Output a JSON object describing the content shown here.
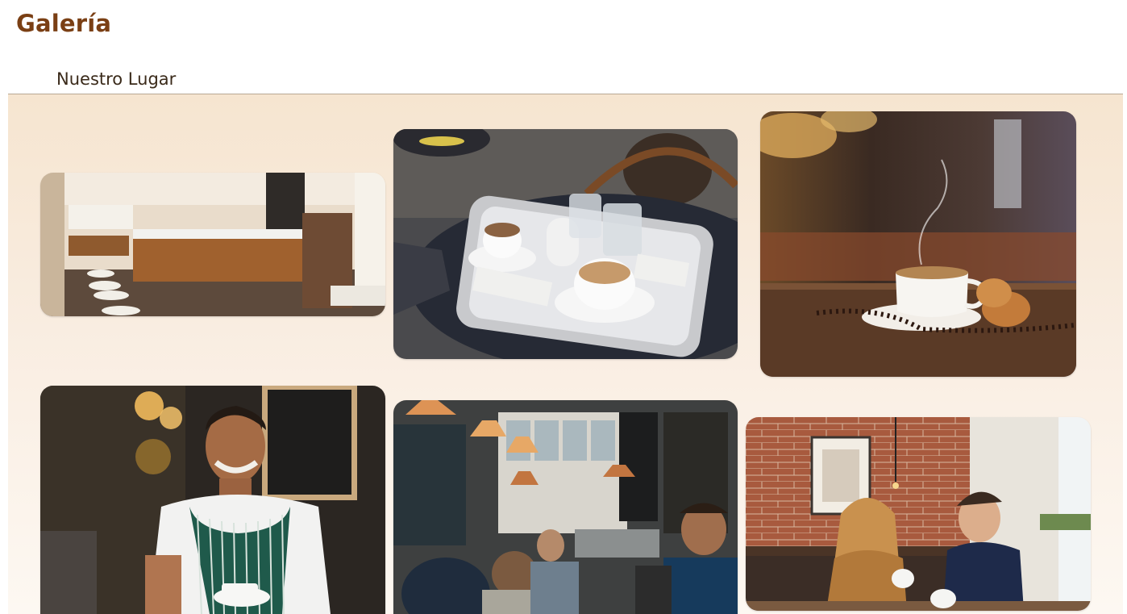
{
  "page": {
    "title": "Galería"
  },
  "section": {
    "title": "Nuestro Lugar"
  },
  "gallery": {
    "photos": [
      {
        "name": "cafe-interior-counter-photo"
      },
      {
        "name": "coffee-tray-table-photo"
      },
      {
        "name": "coffee-cup-beans-photo"
      },
      {
        "name": "barista-smiling-photo"
      },
      {
        "name": "busy-cafe-crowd-photo"
      },
      {
        "name": "couple-brick-wall-cafe-photo"
      }
    ]
  }
}
